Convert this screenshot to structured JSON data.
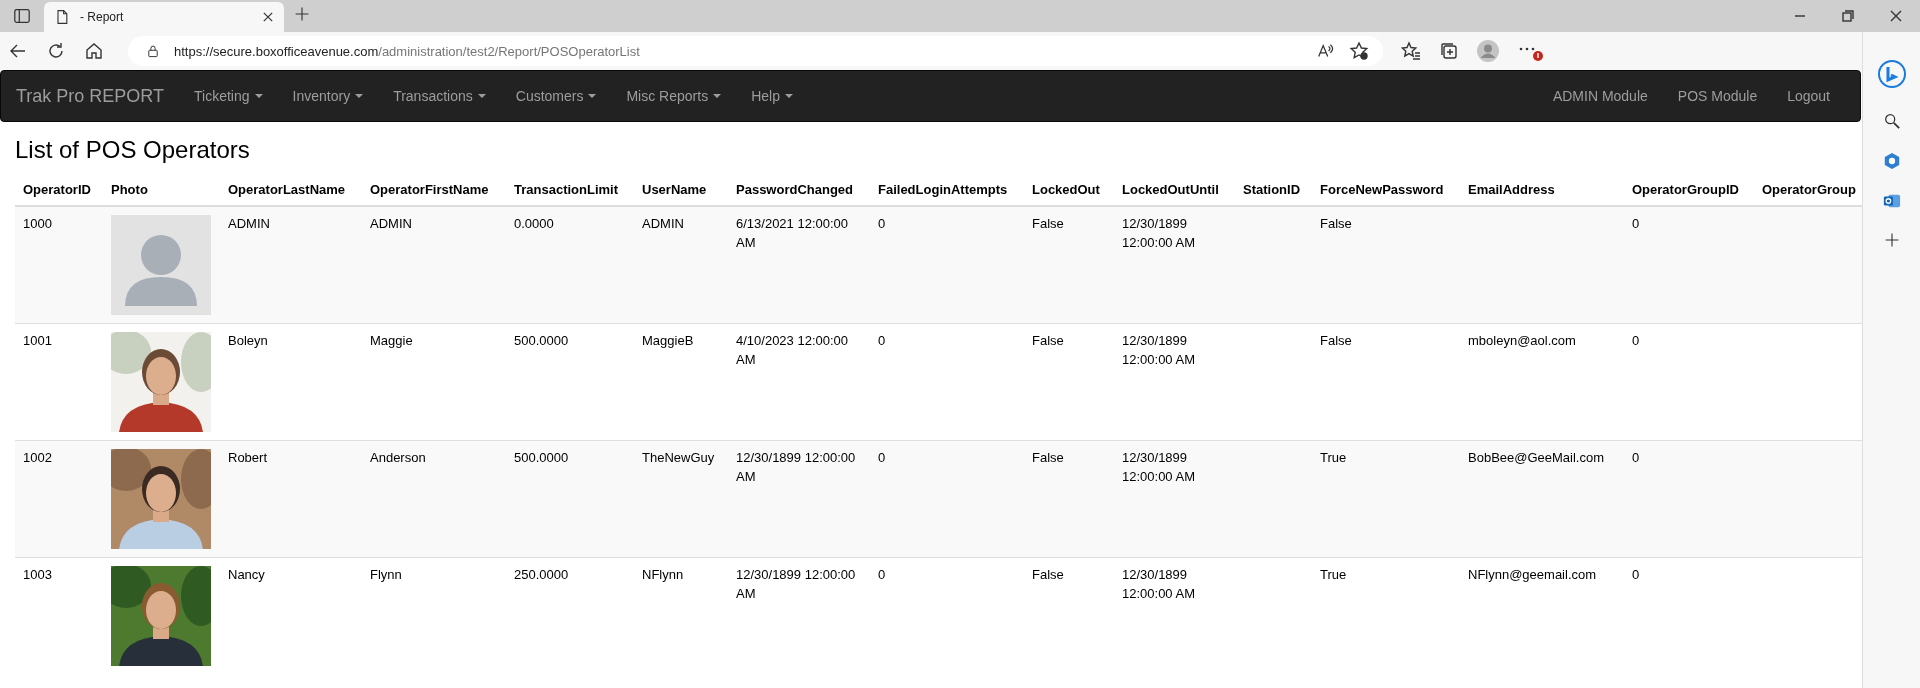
{
  "browser": {
    "tab_title": "- Report",
    "url_host": "https://secure.boxofficeavenue.com",
    "url_path": "/administration/test2/Report/POSOperatorList"
  },
  "navbar": {
    "brand": "Trak Pro REPORT",
    "menus": [
      {
        "label": "Ticketing"
      },
      {
        "label": "Inventory"
      },
      {
        "label": "Transactions"
      },
      {
        "label": "Customers"
      },
      {
        "label": "Misc Reports"
      },
      {
        "label": "Help"
      }
    ],
    "links": [
      "ADMIN Module",
      "POS Module",
      "Logout"
    ]
  },
  "page_title": "List of POS Operators",
  "table": {
    "columns": [
      "OperatorID",
      "Photo",
      "OperatorLastName",
      "OperatorFirstName",
      "TransactionLimit",
      "UserName",
      "PasswordChanged",
      "FailedLoginAttempts",
      "LockedOut",
      "LockedOutUntil",
      "StationID",
      "ForceNewPassword",
      "EmailAddress",
      "OperatorGroupID",
      "OperatorGroup"
    ],
    "rows": [
      {
        "operator_id": "1000",
        "photo": {
          "kind": "placeholder"
        },
        "last_name": "ADMIN",
        "first_name": "ADMIN",
        "transaction_limit": "0.0000",
        "user_name": "ADMIN",
        "password_changed": "6/13/2021 12:00:00 AM",
        "failed_login_attempts": "0",
        "locked_out": "False",
        "locked_out_until": "12/30/1899 12:00:00 AM",
        "force_new_password": "False",
        "operator_group_id": "0"
      },
      {
        "operator_id": "1001",
        "last_name": "Boleyn",
        "first_name": "Maggie",
        "transaction_limit": "500.0000",
        "user_name": "MaggieB",
        "password_changed": "4/10/2023 12:00:00 AM",
        "failed_login_attempts": "0",
        "locked_out": "False",
        "locked_out_until": "12/30/1899 12:00:00 AM",
        "force_new_password": "False",
        "email_address": "mboleyn@aol.com",
        "operator_group_id": "0"
      },
      {
        "operator_id": "1002",
        "last_name": "Robert",
        "first_name": "Anderson",
        "transaction_limit": "500.0000",
        "user_name": "TheNewGuy",
        "password_changed": "12/30/1899 12:00:00 AM",
        "failed_login_attempts": "0",
        "locked_out": "False",
        "locked_out_until": "12/30/1899 12:00:00 AM",
        "force_new_password": "True",
        "email_address": "BobBee@GeeMail.com",
        "operator_group_id": "0"
      },
      {
        "operator_id": "1003",
        "last_name": "Nancy",
        "first_name": "Flynn",
        "transaction_limit": "250.0000",
        "user_name": "NFlynn",
        "password_changed": "12/30/1899 12:00:00 AM",
        "failed_login_attempts": "0",
        "locked_out": "False",
        "locked_out_until": "12/30/1899 12:00:00 AM",
        "force_new_password": "True",
        "email_address": "NFlynn@geemail.com",
        "operator_group_id": "0"
      }
    ]
  }
}
